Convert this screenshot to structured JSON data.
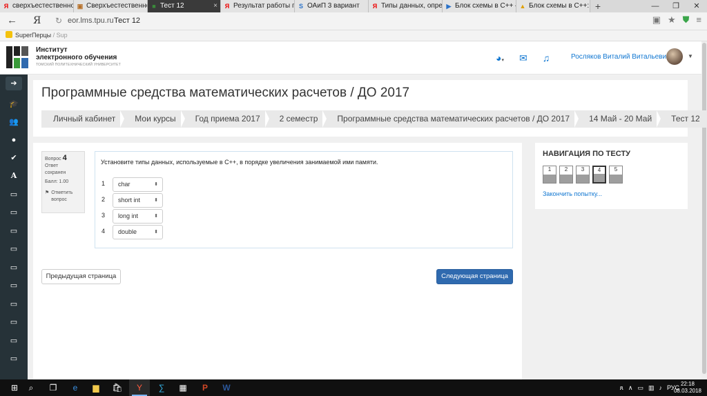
{
  "browser": {
    "tabs": [
      {
        "favicon": "Я",
        "label": "сверхъестественное с",
        "active": false,
        "width": 107
      },
      {
        "favicon": "▣",
        "label": "Сверхъестественное",
        "active": false,
        "width": 107
      },
      {
        "favicon": "■",
        "label": "Тест 12",
        "active": true,
        "width": 107
      },
      {
        "favicon": "Я",
        "label": "Результат работы про",
        "active": false,
        "width": 107
      },
      {
        "favicon": "S",
        "label": "ОАиП 3 вариант",
        "active": false,
        "width": 107
      },
      {
        "favicon": "Я",
        "label": "Типы данных, опреде",
        "active": false,
        "width": 107
      },
      {
        "favicon": "▶",
        "label": "Блок схемы в С++ —",
        "active": false,
        "width": 107
      },
      {
        "favicon": "▲",
        "label": "Блок схемы в С++: 14",
        "active": false,
        "width": 107
      }
    ],
    "new_tab": "+",
    "address_url": "eor.lms.tpu.ru",
    "address_title": "Тест 12",
    "bookmarks_label": "SuperПерцы",
    "bookmarks_sep": " / Sup"
  },
  "site": {
    "logo_line1": "Институт",
    "logo_line2": "электронного обучения",
    "logo_sub": "ТОМСКИЙ ПОЛИТЕХНИЧЕСКИЙ УНИВЕРСИТЕТ",
    "user_name": "Росляков Виталий Витальевич"
  },
  "page": {
    "title": "Программные средства математических расчетов / ДО 2017",
    "breadcrumbs": [
      "Личный кабинет",
      "Мои курсы",
      "Год приема 2017",
      "2 семестр",
      "Программные средства математических расчетов / ДО 2017",
      "14 Май - 20 Май",
      "Тест 12"
    ]
  },
  "question": {
    "label": "Вопрос",
    "number": "4",
    "status_line1": "Ответ",
    "status_line2": "сохранен",
    "score": "Балл: 1.00",
    "flag_line1": "Отметить",
    "flag_line2": "вопрос",
    "text": "Установите типы данных, используемые в С++, в порядке увеличения занимаемой ими памяти.",
    "answers": [
      {
        "num": "1",
        "value": "char"
      },
      {
        "num": "2",
        "value": "short int"
      },
      {
        "num": "3",
        "value": "long int"
      },
      {
        "num": "4",
        "value": "double"
      }
    ]
  },
  "buttons": {
    "prev": "Предыдущая страница",
    "next": "Следующая страница"
  },
  "quiz_nav": {
    "title": "НАВИГАЦИЯ ПО ТЕСТУ",
    "pages": [
      "1",
      "2",
      "3",
      "4",
      "5"
    ],
    "current": "4",
    "finish_link": "Закончить попытку..."
  },
  "taskbar": {
    "lang": "РУС",
    "time": "22:18",
    "date": "08.03.2018"
  }
}
